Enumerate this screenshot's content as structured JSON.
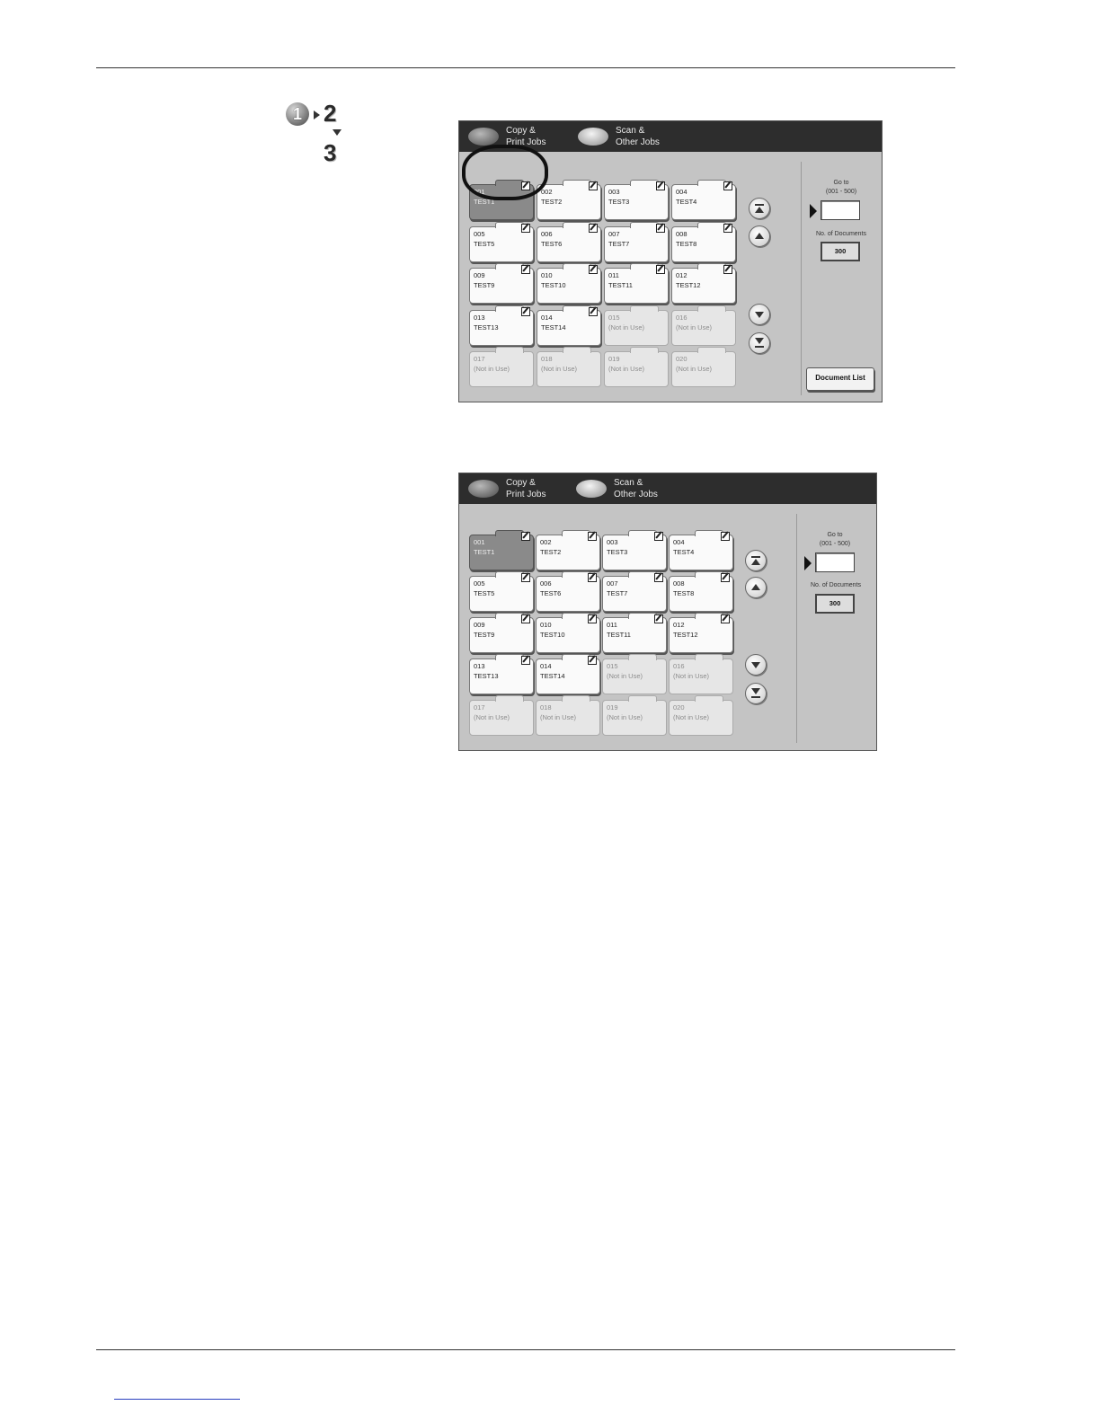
{
  "steps": {
    "step1": "1",
    "step2": "2",
    "step3": "3"
  },
  "screens": [
    {
      "header": {
        "tab1": "Copy &\nPrint Jobs",
        "tab2": "Scan &\nOther Jobs"
      },
      "folders": [
        {
          "number": "001",
          "name": "TEST1",
          "state": "selected"
        },
        {
          "number": "002",
          "name": "TEST2",
          "state": "used"
        },
        {
          "number": "003",
          "name": "TEST3",
          "state": "used"
        },
        {
          "number": "004",
          "name": "TEST4",
          "state": "used"
        },
        {
          "number": "005",
          "name": "TEST5",
          "state": "used"
        },
        {
          "number": "006",
          "name": "TEST6",
          "state": "used"
        },
        {
          "number": "007",
          "name": "TEST7",
          "state": "used"
        },
        {
          "number": "008",
          "name": "TEST8",
          "state": "used"
        },
        {
          "number": "009",
          "name": "TEST9",
          "state": "used"
        },
        {
          "number": "010",
          "name": "TEST10",
          "state": "used"
        },
        {
          "number": "011",
          "name": "TEST11",
          "state": "used"
        },
        {
          "number": "012",
          "name": "TEST12",
          "state": "used"
        },
        {
          "number": "013",
          "name": "TEST13",
          "state": "used"
        },
        {
          "number": "014",
          "name": "TEST14",
          "state": "used"
        },
        {
          "number": "015",
          "name": "(Not in Use)",
          "state": "unused"
        },
        {
          "number": "016",
          "name": "(Not in Use)",
          "state": "unused"
        },
        {
          "number": "017",
          "name": "(Not in Use)",
          "state": "unused"
        },
        {
          "number": "018",
          "name": "(Not in Use)",
          "state": "unused"
        },
        {
          "number": "019",
          "name": "(Not in Use)",
          "state": "unused"
        },
        {
          "number": "020",
          "name": "(Not in Use)",
          "state": "unused"
        }
      ],
      "side": {
        "goto_label": "Go to\n(001 - 500)",
        "goto_value": "",
        "count_label": "No. of Documents",
        "count_value": "300",
        "document_list": "Document List"
      }
    },
    {
      "header": {
        "tab1": "Copy &\nPrint Jobs",
        "tab2": "Scan &\nOther Jobs"
      },
      "folders": [
        {
          "number": "001",
          "name": "TEST1",
          "state": "selected"
        },
        {
          "number": "002",
          "name": "TEST2",
          "state": "used"
        },
        {
          "number": "003",
          "name": "TEST3",
          "state": "used"
        },
        {
          "number": "004",
          "name": "TEST4",
          "state": "used"
        },
        {
          "number": "005",
          "name": "TEST5",
          "state": "used"
        },
        {
          "number": "006",
          "name": "TEST6",
          "state": "used"
        },
        {
          "number": "007",
          "name": "TEST7",
          "state": "used"
        },
        {
          "number": "008",
          "name": "TEST8",
          "state": "used"
        },
        {
          "number": "009",
          "name": "TEST9",
          "state": "used"
        },
        {
          "number": "010",
          "name": "TEST10",
          "state": "used"
        },
        {
          "number": "011",
          "name": "TEST11",
          "state": "used"
        },
        {
          "number": "012",
          "name": "TEST12",
          "state": "used"
        },
        {
          "number": "013",
          "name": "TEST13",
          "state": "used"
        },
        {
          "number": "014",
          "name": "TEST14",
          "state": "used"
        },
        {
          "number": "015",
          "name": "(Not in Use)",
          "state": "unused"
        },
        {
          "number": "016",
          "name": "(Not in Use)",
          "state": "unused"
        },
        {
          "number": "017",
          "name": "(Not in Use)",
          "state": "unused"
        },
        {
          "number": "018",
          "name": "(Not in Use)",
          "state": "unused"
        },
        {
          "number": "019",
          "name": "(Not in Use)",
          "state": "unused"
        },
        {
          "number": "020",
          "name": "(Not in Use)",
          "state": "unused"
        }
      ],
      "side": {
        "goto_label": "Go to\n(001 - 500)",
        "goto_value": "",
        "count_label": "No. of Documents",
        "count_value": "300"
      }
    }
  ]
}
